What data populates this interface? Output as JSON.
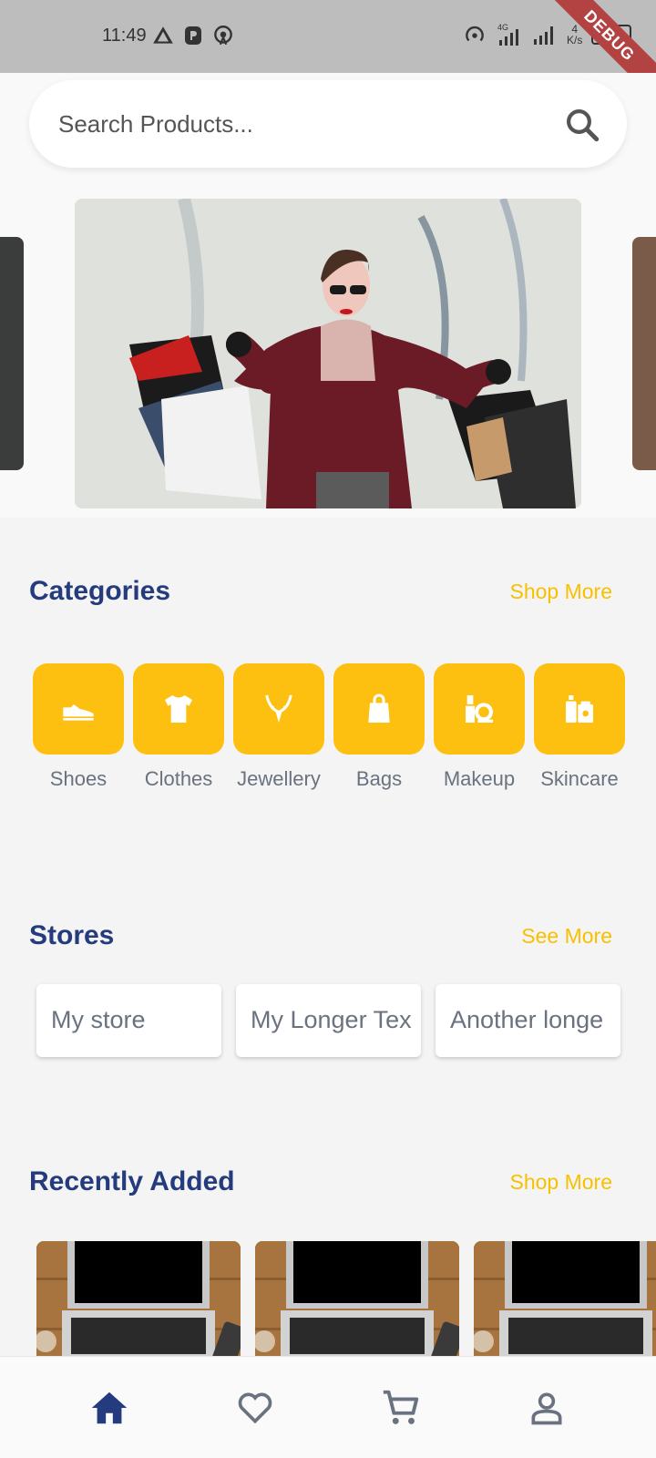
{
  "status_bar": {
    "time": "11:49",
    "network": "4G",
    "speed_value": "4",
    "speed_unit": "K/s",
    "battery": "35",
    "debug_label": "DEBUG"
  },
  "search": {
    "placeholder": "Search Products..."
  },
  "categories": {
    "title": "Categories",
    "more_label": "Shop More",
    "items": [
      {
        "label": "Shoes",
        "icon": "shoe-icon"
      },
      {
        "label": "Clothes",
        "icon": "tshirt-icon"
      },
      {
        "label": "Jewellery",
        "icon": "necklace-icon"
      },
      {
        "label": "Bags",
        "icon": "bag-icon"
      },
      {
        "label": "Makeup",
        "icon": "makeup-icon"
      },
      {
        "label": "Skincare",
        "icon": "skincare-icon"
      }
    ]
  },
  "stores": {
    "title": "Stores",
    "more_label": "See More",
    "items": [
      "My store",
      "My Longer Tex",
      "Another longe"
    ]
  },
  "recent": {
    "title": "Recently Added",
    "more_label": "Shop More"
  },
  "bottom_nav": {
    "items": [
      "home-icon",
      "heart-icon",
      "cart-icon",
      "profile-icon"
    ],
    "active": "home-icon"
  },
  "colors": {
    "primary": "#243b7d",
    "accent": "#fdc010",
    "link": "#f8c000",
    "muted_text": "#6a7280"
  }
}
